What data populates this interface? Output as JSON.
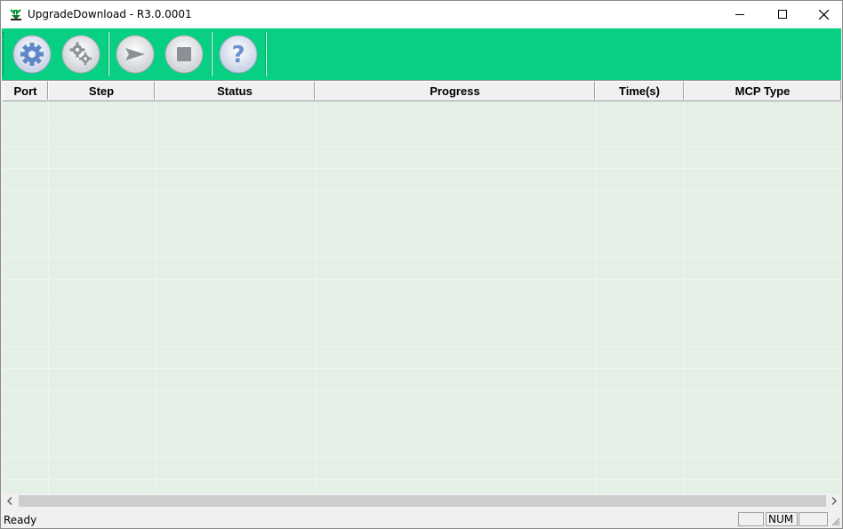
{
  "window": {
    "title": "UpgradeDownload - R3.0.0001",
    "controls": {
      "minimize": "minimize-icon",
      "maximize": "maximize-icon",
      "close": "close-icon"
    }
  },
  "toolbar": {
    "background": "#07d082",
    "buttons": [
      {
        "name": "settings-button",
        "icon": "gear-icon"
      },
      {
        "name": "advanced-settings-button",
        "icon": "gears-icon"
      },
      {
        "name": "start-button",
        "icon": "play-arrow-icon"
      },
      {
        "name": "stop-button",
        "icon": "stop-square-icon"
      },
      {
        "name": "help-button",
        "icon": "question-icon",
        "glyph": "?"
      }
    ]
  },
  "table": {
    "columns": [
      "Port",
      "Step",
      "Status",
      "Progress",
      "Time(s)",
      "MCP Type"
    ],
    "rows": []
  },
  "statusbar": {
    "text": "Ready",
    "num_indicator": "NUM"
  }
}
